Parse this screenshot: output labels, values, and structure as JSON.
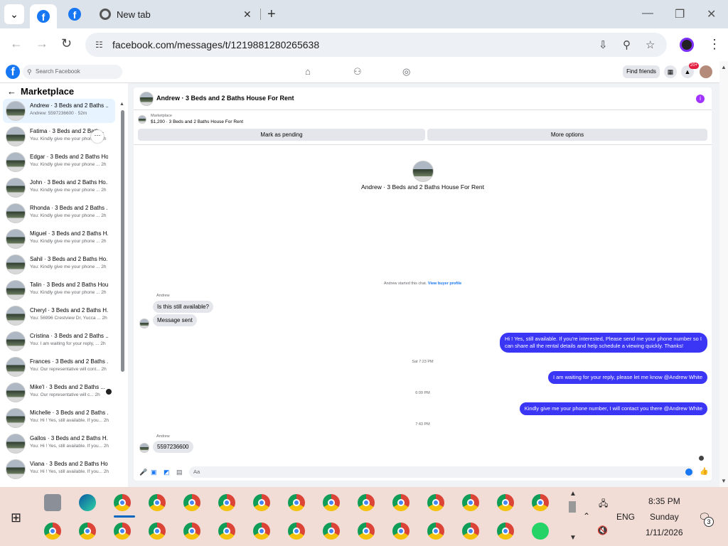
{
  "browser": {
    "tabs": [
      {
        "label": ""
      },
      {
        "label": ""
      },
      {
        "label": "New tab"
      }
    ],
    "url": "facebook.com/messages/t/1219881280265638"
  },
  "fb": {
    "search_placeholder": "Search Facebook",
    "find_friends": "Find friends",
    "notif_badge": "20+"
  },
  "sidebar": {
    "title": "Marketplace",
    "items": [
      {
        "name": "Andrew · 3 Beds and 2 Baths ...",
        "sub": "Andrew: 5597236600 · 52m"
      },
      {
        "name": "Fatima · 3 Beds and 2 Bath...",
        "sub": "You: Kindly give me your phone ...  2h"
      },
      {
        "name": "Edgar · 3 Beds and 2 Baths Ho...",
        "sub": "You: Kindly give me your phone ...  2h"
      },
      {
        "name": "John · 3 Beds and 2 Baths Ho...",
        "sub": "You: Kindly give me your phone ...  2h"
      },
      {
        "name": "Rhonda · 3 Beds and 2 Baths ...",
        "sub": "You: Kindly give me your phone ...  2h"
      },
      {
        "name": "Miguel · 3 Beds and 2 Baths H...",
        "sub": "You: Kindly give me your phone ...  2h"
      },
      {
        "name": "Sahil · 3 Beds and 2 Baths Ho...",
        "sub": "You: Kindly give me your phone ...  2h"
      },
      {
        "name": "Talin · 3 Beds and 2 Baths Hou...",
        "sub": "You: Kindly give me your phone ...  2h"
      },
      {
        "name": "Cheryl · 3 Beds and 2 Baths H...",
        "sub": "You: 56996 Crestview Dr, Yucca ...  2h"
      },
      {
        "name": "Cristina · 3 Beds and 2 Baths ...",
        "sub": "You: I am waiting for your reply, ...  2h"
      },
      {
        "name": "Frances · 3 Beds and 2 Baths ...",
        "sub": "You: Our representative will cont...  2h"
      },
      {
        "name": "Mike'l · 3 Beds and 2 Baths ...",
        "sub": "You: Our representative will c...  2h"
      },
      {
        "name": "Michelle · 3 Beds and 2 Baths ...",
        "sub": "You: Hi ! Yes, still available. If you...  2h"
      },
      {
        "name": "Gallos · 3 Beds and 2 Baths H...",
        "sub": "You: Hi ! Yes, still available. If you...  2h"
      },
      {
        "name": "Viana · 3 Beds and 2 Baths Ho...",
        "sub": "You: Hi ! Yes, still available. If you...  2h"
      }
    ]
  },
  "chat": {
    "title": "Andrew · 3 Beds and 2 Baths House For Rent",
    "marketplace_label": "Marketplace",
    "listing": "$1,200 · 3 Beds and 2 Baths House For Rent",
    "mark_pending": "Mark as pending",
    "more_options": "More options",
    "center_name": "Andrew · 3 Beds and 2 Baths House For Rent",
    "started_text": "Andrew started this chat.",
    "view_profile": "View buyer profile",
    "sender1": "Andrew",
    "msg_in1": "Is this still available?",
    "msg_in2": "Message sent",
    "msg_out1": "Hi ! Yes, still available. If you're interested, Please send me your phone number so I can share all the rental details and help schedule a viewing quickly. Thanks!",
    "ts1": "Sat 7:23 PM",
    "msg_out2": "I am waiting for your reply, please let me know @Andrew White",
    "ts2": "6:09 PM",
    "msg_out3": "Kindly give me your phone number, I will contact you there @Andrew White",
    "ts3": "7:43 PM",
    "sender2": "Andrew",
    "msg_in3": "5597236600",
    "composer_placeholder": "Aa"
  },
  "taskbar": {
    "lang": "ENG",
    "time": "8:35 PM",
    "day": "Sunday",
    "date": "1/11/2026",
    "notif_count": "3"
  }
}
